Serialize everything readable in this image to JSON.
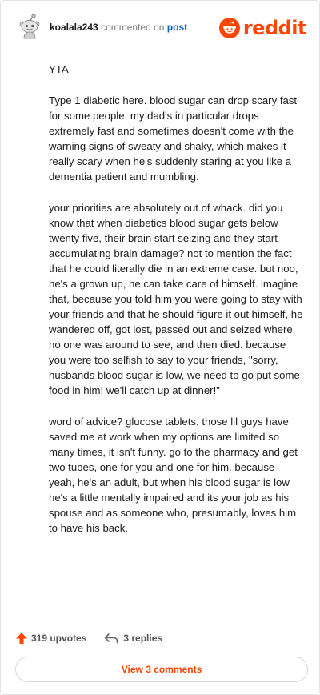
{
  "header": {
    "username": "koalala243",
    "action": "commented on",
    "target": "post",
    "brand": "reddit"
  },
  "comment": {
    "paragraphs": [
      "YTA",
      "Type 1 diabetic here. blood sugar can drop scary fast for some people. my dad's in particular drops extremely fast and sometimes doesn't come with the warning signs of sweaty and shaky, which makes it really scary when he's suddenly staring at you like a dementia patient and mumbling.",
      "your priorities are absolutely out of whack. did you know that when diabetics blood sugar gets below twenty five, their brain start seizing and they start accumulating brain damage? not to mention the fact that he could literally die in an extreme case. but noo, he's a grown up, he can take care of himself. imagine that, because you told him you were going to stay with your friends and that he should figure it out himself, he wandered off, got lost, passed out and seized where no one was around to see, and then died. because you were too selfish to say to your friends, \"sorry, husbands blood sugar is low, we need to go put some food in him! we'll catch up at dinner!\"",
      "word of advice? glucose tablets. those lil guys have saved me at work when my options are limited so many times, it isn't funny. go to the pharmacy and get two tubes, one for you and one for him. because yeah, he's an adult, but when his blood sugar is low he's a little mentally impaired and its your job as his spouse and as someone who, presumably, loves him to have his back."
    ]
  },
  "footer": {
    "upvotes": "319 upvotes",
    "replies": "3 replies",
    "view_comments": "View 3 comments"
  },
  "colors": {
    "brand": "#ff4500",
    "link": "#0b63b8"
  },
  "icons": [
    "snoo-avatar-icon",
    "reddit-logo-icon",
    "upvote-arrow-icon",
    "reply-arrow-icon"
  ]
}
